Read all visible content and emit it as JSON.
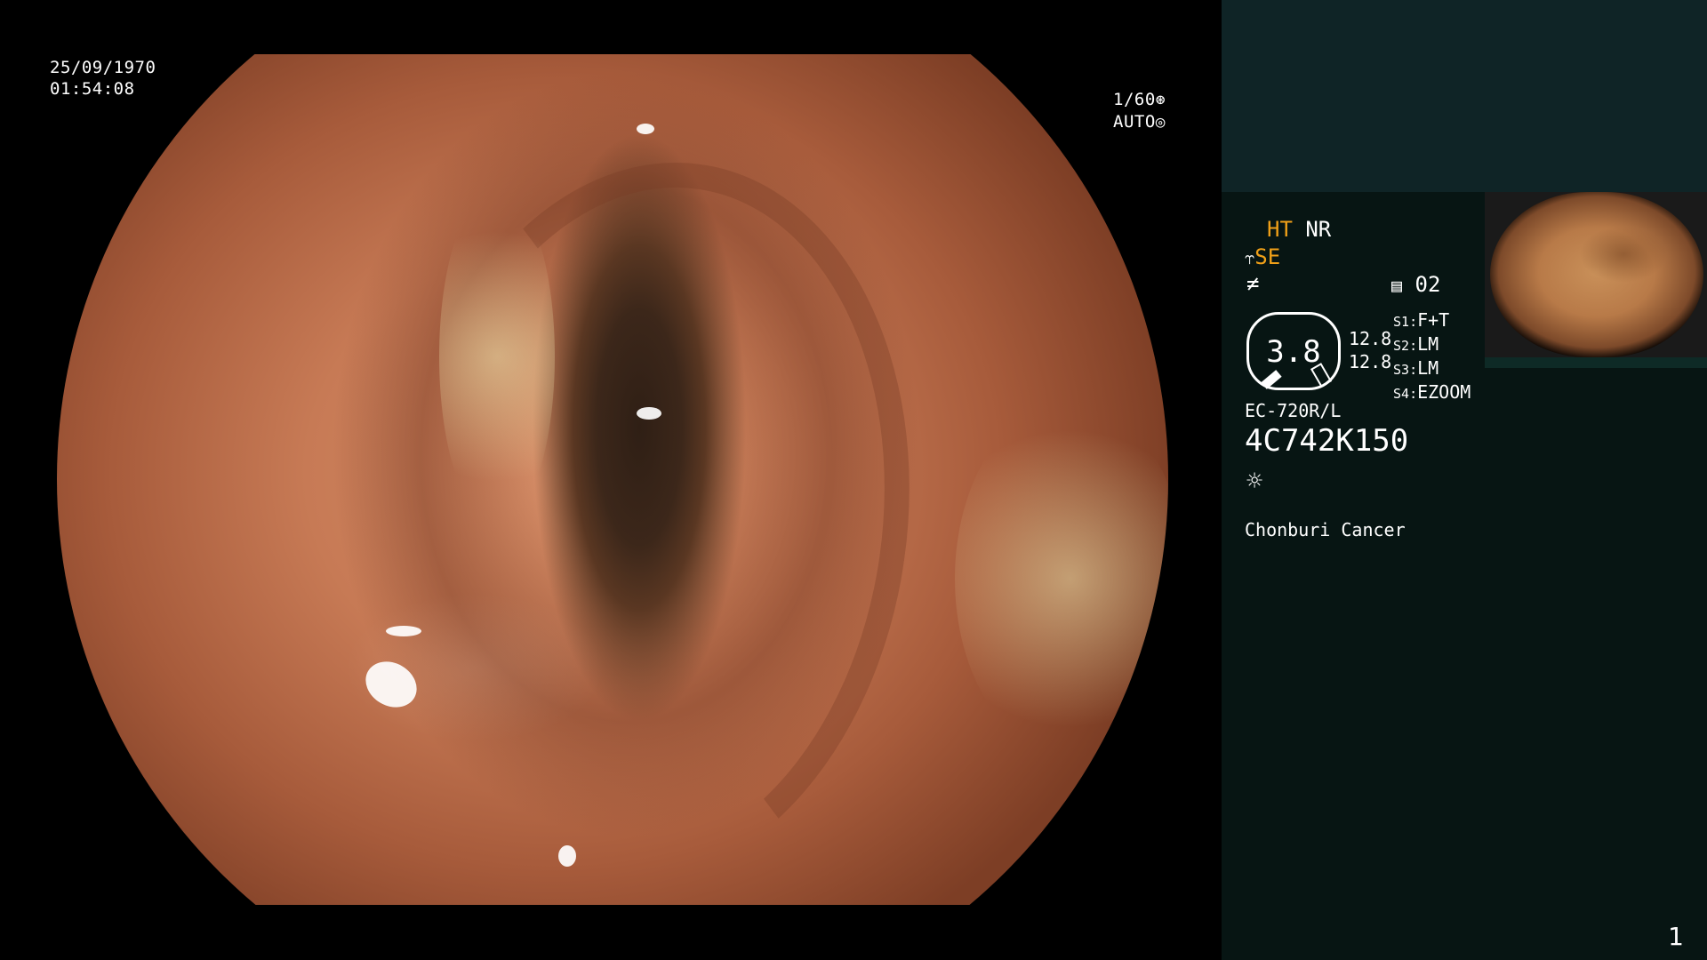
{
  "overlay": {
    "date": "25/09/1970",
    "time": "01:54:08",
    "shutter": "1/60",
    "shutter_icon": "aperture-icon",
    "exposure": "AUTO",
    "exposure_icon": "iris-icon"
  },
  "panel": {
    "ht": "HT",
    "nr": "NR",
    "se": "SE",
    "se_icon": "scope-icon",
    "filter_icon": "not-equal-icon",
    "memory_icon": "memory-card-icon",
    "memory": "02",
    "dial_value": "3.8",
    "side_values": [
      "12.8",
      "12.8"
    ],
    "switches": [
      {
        "key": "S1",
        "value": "F+T"
      },
      {
        "key": "S2",
        "value": "LM"
      },
      {
        "key": "S3",
        "value": "LM"
      },
      {
        "key": "S4",
        "value": "EZOOM"
      }
    ],
    "model": "EC-720R/L",
    "serial": "4C742K150",
    "light_icon": "sun-icon",
    "institution": "Chonburi Cancer"
  },
  "page_number": "1",
  "colors": {
    "panel_bg": "#071513",
    "panel_top_bg": "#0f2426",
    "accent": "#f0a018"
  }
}
